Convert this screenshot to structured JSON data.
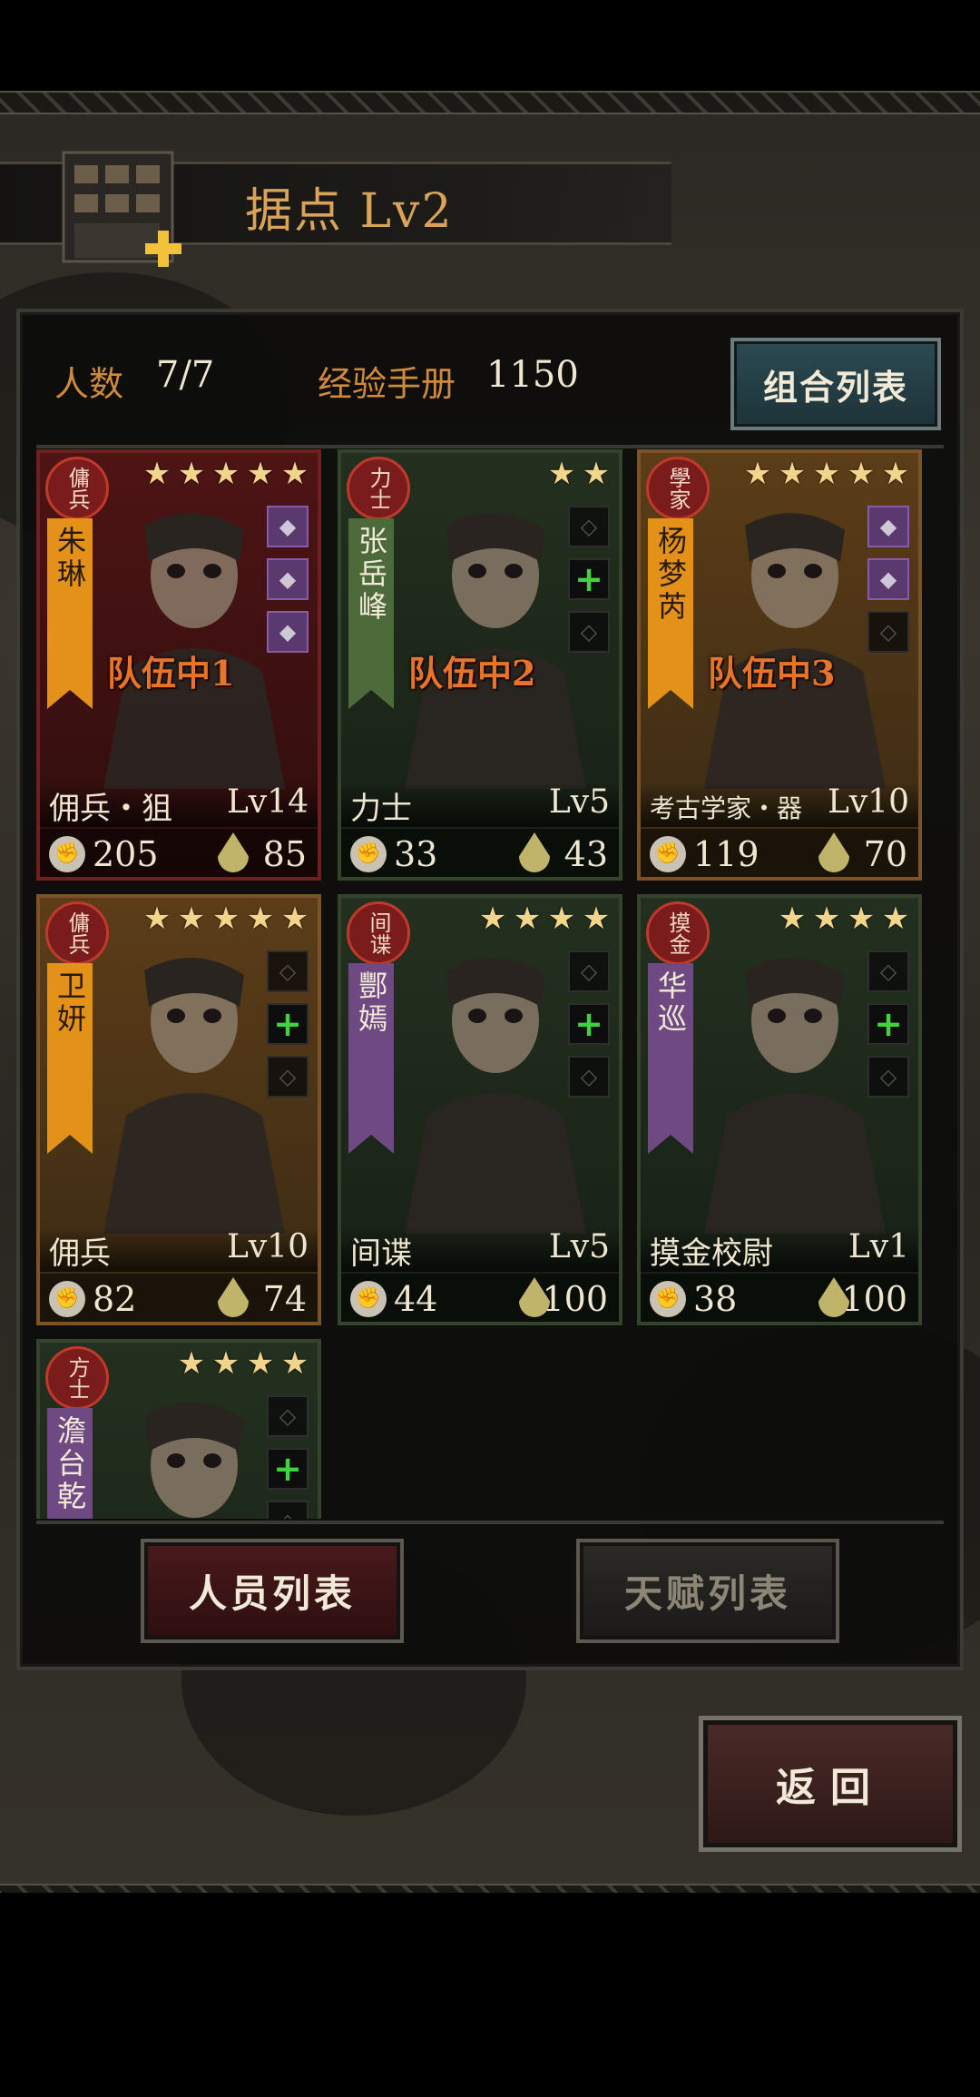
{
  "header": {
    "title": "据点 Lv2"
  },
  "stats": {
    "people_label": "人数",
    "people_value": "7/7",
    "exp_label": "经验手册",
    "exp_value": "1150",
    "combo_button": "组合列表"
  },
  "cards": [
    {
      "badge": "傭兵",
      "name": "朱琳",
      "ribbon": "orange",
      "bg": "red",
      "stars": 5,
      "team": "队伍中1",
      "class": "佣兵・狙",
      "level": "Lv14",
      "attack": "205",
      "hp": "85",
      "equip": [
        "filled",
        "filled",
        "filled"
      ]
    },
    {
      "badge": "力士",
      "name": "张岳峰",
      "ribbon": "green",
      "bg": "green",
      "stars": 2,
      "team": "队伍中2",
      "class": "力士",
      "level": "Lv5",
      "attack": "33",
      "hp": "43",
      "equip": [
        "empty",
        "plus",
        "empty"
      ]
    },
    {
      "badge": "學家",
      "name": "杨梦芮",
      "ribbon": "orange",
      "bg": "orange",
      "stars": 5,
      "team": "队伍中3",
      "class": "考古学家・器",
      "level": "Lv10",
      "attack": "119",
      "hp": "70",
      "equip": [
        "filled",
        "filled",
        "empty"
      ]
    },
    {
      "badge": "傭兵",
      "name": "卫妍",
      "ribbon": "orange",
      "bg": "orange",
      "stars": 5,
      "team": "",
      "class": "佣兵",
      "level": "Lv10",
      "attack": "82",
      "hp": "74",
      "equip": [
        "empty",
        "plus",
        "empty"
      ]
    },
    {
      "badge": "间谍",
      "name": "酆嫣",
      "ribbon": "purple",
      "bg": "green",
      "stars": 4,
      "team": "",
      "class": "间谍",
      "level": "Lv5",
      "attack": "44",
      "hp": "100",
      "equip": [
        "empty",
        "plus",
        "empty"
      ]
    },
    {
      "badge": "摸金",
      "name": "华巡",
      "ribbon": "purple",
      "bg": "green",
      "stars": 4,
      "team": "",
      "class": "摸金校尉",
      "level": "Lv1",
      "attack": "38",
      "hp": "100",
      "equip": [
        "empty",
        "plus",
        "empty"
      ]
    },
    {
      "badge": "方士",
      "name": "澹台乾",
      "ribbon": "purple",
      "bg": "green",
      "stars": 4,
      "team": "",
      "class": "",
      "level": "",
      "attack": "",
      "hp": "",
      "equip": [
        "empty",
        "plus",
        "empty"
      ]
    }
  ],
  "buttons": {
    "staff_list": "人员列表",
    "talent_list": "天赋列表",
    "return": "返回"
  },
  "icons": {
    "attack": "fist-icon",
    "hp": "drop-icon",
    "star": "star-icon",
    "plus": "plus-icon"
  }
}
